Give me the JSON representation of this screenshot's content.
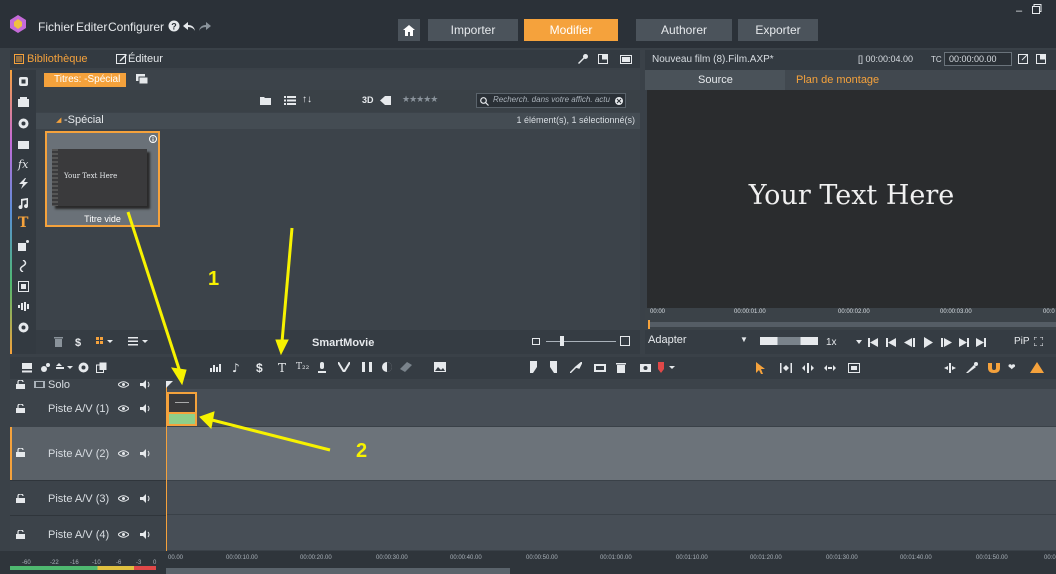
{
  "menu": {
    "file": "Fichier",
    "edit": "Editer",
    "configure": "Configurer"
  },
  "modes": [
    {
      "label": "Importer",
      "active": false
    },
    {
      "label": "Modifier",
      "active": true
    },
    {
      "label": "Authorer",
      "active": false
    },
    {
      "label": "Exporter",
      "active": false
    }
  ],
  "library": {
    "tab_library": "Bibliothèque",
    "tab_editor": "Éditeur",
    "category_tab": "Titres: -Spécial",
    "filter_3d": "3D",
    "search_placeholder": "Recherch. dans votre affich. actu",
    "collection": "-Spécial",
    "count": "1 élément(s), 1 sélectionné(s)",
    "item_thumb_text": "Your Text Here",
    "item_label": "Titre vide",
    "smartmovie": "SmartMovie"
  },
  "player": {
    "project": "Nouveau film (8).Film.AXP*",
    "duration": "[] 00:00:04.00",
    "tc_label": "TC",
    "timecode": "00:00:00.00",
    "tab_source": "Source",
    "tab_timeline": "Plan de montage",
    "preview_text": "Your Text Here",
    "ruler_ticks": [
      "00:00",
      "00:00:01.00",
      "00:00:02.00",
      "00:00:03.00",
      "00:0"
    ],
    "fit": "Adapter",
    "speed": "1x",
    "pip": "PiP"
  },
  "timeline": {
    "tracks": [
      "Solo",
      "Piste A/V (1)",
      "Piste A/V (2)",
      "Piste A/V (3)",
      "Piste A/V (4)"
    ],
    "ruler": [
      "00.00",
      "00:00:10.00",
      "00:00:20.00",
      "00:00:30.00",
      "00:00:40.00",
      "00:00:50.00",
      "00:01:00.00",
      "00:01:10.00",
      "00:01:20.00",
      "00:01:30.00",
      "00:01:40.00",
      "00:01:50.00",
      "00:0"
    ],
    "meter": [
      "-60",
      "-22",
      "-16",
      "-10",
      "-6",
      "-3",
      "0"
    ]
  },
  "annotations": {
    "label1": "1",
    "label2": "2"
  },
  "colors": {
    "accent": "#f5a23c",
    "annotation": "#f7f200"
  }
}
